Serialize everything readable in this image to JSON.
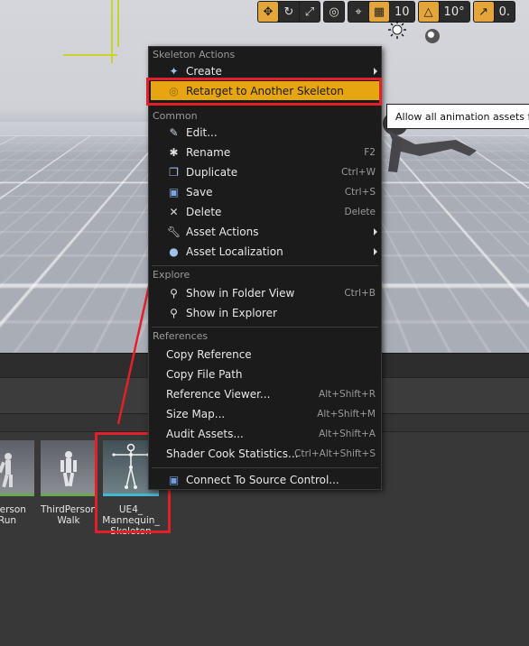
{
  "viewport": {
    "toolbar": {
      "grid_snap_value": "10",
      "rotation_snap_value": "10°",
      "scale_snap_value": "0.",
      "icons": [
        "translate-icon",
        "rotate-icon",
        "scale-icon",
        "world-icon",
        "surface-snap-icon",
        "grid-snap-icon",
        "rotation-snap-icon",
        "scale-snap-icon"
      ]
    },
    "tooltip": "Allow all animation assets for"
  },
  "content_browser": {
    "assets": [
      {
        "label_line1": "dPerson",
        "label_line2": "Run"
      },
      {
        "label_line1": "ThirdPerson",
        "label_line2": "Walk"
      },
      {
        "label_line1": "UE4_",
        "label_line2": "Mannequin_",
        "label_line3": "Skeleton"
      }
    ]
  },
  "menu": {
    "sections": {
      "skeleton_actions": "Skeleton Actions",
      "common": "Common",
      "explore": "Explore",
      "references": "References"
    },
    "items": {
      "create": {
        "label": "Create",
        "icon": "create-icon"
      },
      "retarget": {
        "label": "Retarget to Another Skeleton",
        "icon": "retarget-icon"
      },
      "edit": {
        "label": "Edit...",
        "icon": "edit-icon"
      },
      "rename": {
        "label": "Rename",
        "shortcut": "F2",
        "icon": "rename-icon"
      },
      "duplicate": {
        "label": "Duplicate",
        "shortcut": "Ctrl+W",
        "icon": "duplicate-icon"
      },
      "save": {
        "label": "Save",
        "shortcut": "Ctrl+S",
        "icon": "save-icon"
      },
      "delete": {
        "label": "Delete",
        "shortcut": "Delete",
        "icon": "delete-icon"
      },
      "asset_actions": {
        "label": "Asset Actions",
        "icon": "wrench-icon"
      },
      "asset_localization": {
        "label": "Asset Localization",
        "icon": "globe-icon"
      },
      "show_folder": {
        "label": "Show in Folder View",
        "shortcut": "Ctrl+B",
        "icon": "magnifier-icon"
      },
      "show_explorer": {
        "label": "Show in Explorer",
        "icon": "magnifier-icon"
      },
      "copy_reference": {
        "label": "Copy Reference"
      },
      "copy_file_path": {
        "label": "Copy File Path"
      },
      "reference_viewer": {
        "label": "Reference Viewer...",
        "shortcut": "Alt+Shift+R"
      },
      "size_map": {
        "label": "Size Map...",
        "shortcut": "Alt+Shift+M"
      },
      "audit_assets": {
        "label": "Audit Assets...",
        "shortcut": "Alt+Shift+A"
      },
      "shader_cook": {
        "label": "Shader Cook Statistics...",
        "shortcut": "Ctrl+Alt+Shift+S"
      },
      "connect_source_control": {
        "label": "Connect To Source Control...",
        "icon": "source-control-icon"
      }
    }
  },
  "colors": {
    "highlight": "#e6a511",
    "annotation_red": "#e3202a",
    "menu_bg": "#1b1b1b",
    "toolbar_active": "#e4a63a"
  }
}
